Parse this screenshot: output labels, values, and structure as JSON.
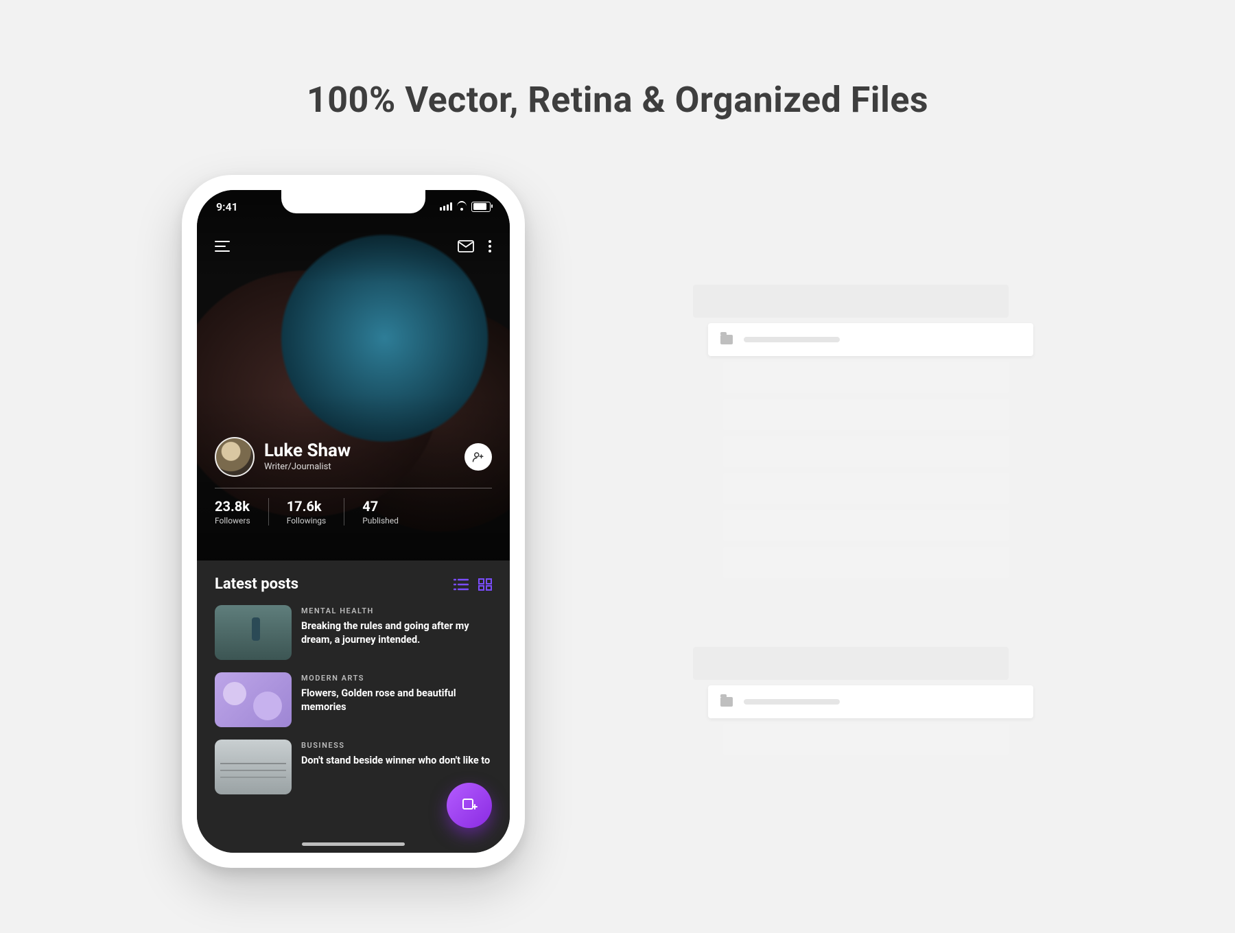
{
  "headline": "100% Vector, Retina & Organized Files",
  "status": {
    "time": "9:41"
  },
  "profile": {
    "name": "Luke Shaw",
    "role": "Writer/Journalist",
    "stats": [
      {
        "value": "23.8k",
        "label": "Followers"
      },
      {
        "value": "17.6k",
        "label": "Followings"
      },
      {
        "value": "47",
        "label": "Published"
      }
    ]
  },
  "latest": {
    "heading": "Latest posts",
    "posts": [
      {
        "category": "MENTAL HEALTH",
        "title": "Breaking the rules and going after my dream, a journey intended."
      },
      {
        "category": "MODERN ARTS",
        "title": "Flowers, Golden rose and beautiful memories"
      },
      {
        "category": "BUSINESS",
        "title": "Don't stand beside winner who don't like to"
      }
    ]
  },
  "icons": {
    "menu": "menu-icon",
    "mail": "mail-icon",
    "more": "more-vertical-icon",
    "add_user": "user-plus-icon",
    "list": "list-view-icon",
    "grid": "grid-view-icon",
    "compose": "compose-icon",
    "folder": "folder-icon"
  },
  "colors": {
    "accent": "#7b4dff",
    "fab_start": "#b45cff",
    "fab_end": "#8a2be2"
  }
}
